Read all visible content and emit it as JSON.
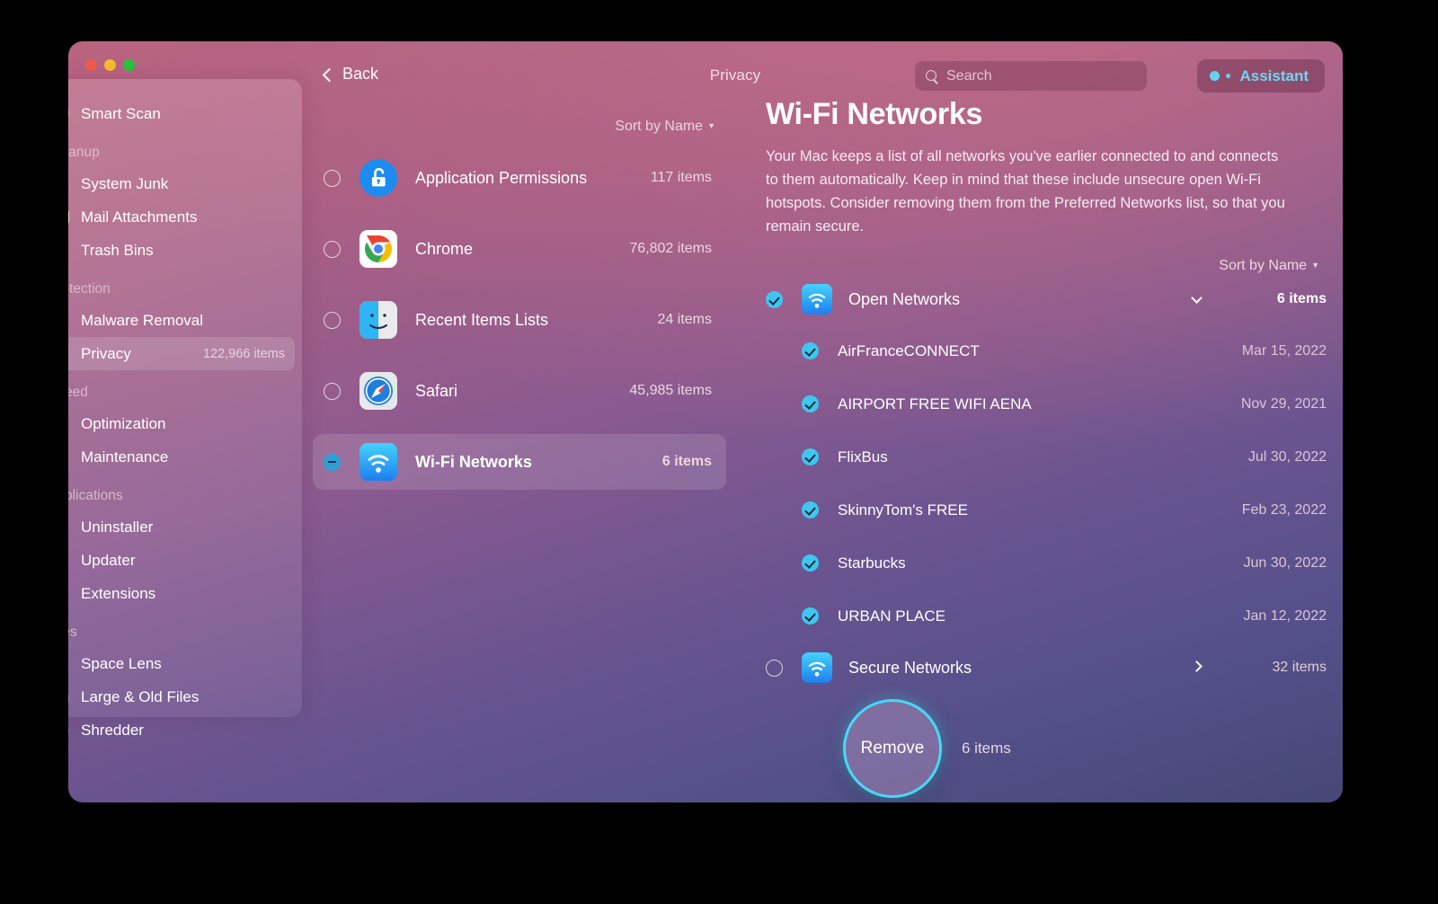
{
  "window": {
    "traffic_lights": [
      "close",
      "minimize",
      "zoom"
    ]
  },
  "toolbar": {
    "back_label": "Back",
    "title": "Privacy",
    "search_placeholder": "Search",
    "assistant_label": "Assistant"
  },
  "sidebar": {
    "items": [
      {
        "label": "Smart Scan",
        "icon": "monitor-scan-icon",
        "type": "item",
        "count": "",
        "selected": false
      },
      {
        "label": "Cleanup",
        "type": "group"
      },
      {
        "label": "System Junk",
        "icon": "junk-broom-icon",
        "type": "item",
        "count": "",
        "selected": false
      },
      {
        "label": "Mail Attachments",
        "icon": "envelope-icon",
        "type": "item",
        "count": "",
        "selected": false
      },
      {
        "label": "Trash Bins",
        "icon": "trash-bin-icon",
        "type": "item",
        "count": "",
        "selected": false
      },
      {
        "label": "Protection",
        "type": "group"
      },
      {
        "label": "Malware Removal",
        "icon": "biohazard-icon",
        "type": "item",
        "count": "",
        "selected": false
      },
      {
        "label": "Privacy",
        "icon": "red-hand-icon",
        "type": "item",
        "count": "122,966 items",
        "selected": true
      },
      {
        "label": "Speed",
        "type": "group"
      },
      {
        "label": "Optimization",
        "icon": "sliders-icon",
        "type": "item",
        "count": "",
        "selected": false
      },
      {
        "label": "Maintenance",
        "icon": "wrench-icon",
        "type": "item",
        "count": "",
        "selected": false
      },
      {
        "label": "Applications",
        "type": "group"
      },
      {
        "label": "Uninstaller",
        "icon": "app-molecule-icon",
        "type": "item",
        "count": "",
        "selected": false
      },
      {
        "label": "Updater",
        "icon": "update-arrow-icon",
        "type": "item",
        "count": "",
        "selected": false
      },
      {
        "label": "Extensions",
        "icon": "puzzle-piece-icon",
        "type": "item",
        "count": "",
        "selected": false
      },
      {
        "label": "Files",
        "type": "group"
      },
      {
        "label": "Space Lens",
        "icon": "planet-lens-icon",
        "type": "item",
        "count": "",
        "selected": false
      },
      {
        "label": "Large & Old Files",
        "icon": "folder-icon",
        "type": "item",
        "count": "",
        "selected": false
      },
      {
        "label": "Shredder",
        "icon": "shredder-icon",
        "type": "item",
        "count": "",
        "selected": false
      }
    ]
  },
  "middle": {
    "sort_label": "Sort by Name",
    "rows": [
      {
        "label": "Application Permissions",
        "count": "117 items",
        "icon": "unlock-blue-icon",
        "state": "unchecked",
        "selected": false
      },
      {
        "label": "Chrome",
        "count": "76,802 items",
        "icon": "chrome-icon",
        "state": "unchecked",
        "selected": false
      },
      {
        "label": "Recent Items Lists",
        "count": "24 items",
        "icon": "finder-icon",
        "state": "unchecked",
        "selected": false
      },
      {
        "label": "Safari",
        "count": "45,985 items",
        "icon": "safari-icon",
        "state": "unchecked",
        "selected": false
      },
      {
        "label": "Wi-Fi Networks",
        "count": "6 items",
        "icon": "wifi-icon",
        "state": "indeterminate",
        "selected": true
      }
    ]
  },
  "detail": {
    "title": "Wi-Fi Networks",
    "description": "Your Mac keeps a list of all networks you've earlier connected to and connects to them automatically. Keep in mind that these include unsecure open Wi-Fi hotspots. Consider removing them from the Preferred Networks list, so that you remain secure.",
    "sort_label": "Sort by Name",
    "groups": [
      {
        "label": "Open Networks",
        "count": "6 items",
        "icon": "wifi-icon",
        "state": "checked",
        "expanded": true,
        "networks": [
          {
            "name": "AirFranceCONNECT",
            "date": "Mar 15, 2022",
            "state": "checked"
          },
          {
            "name": "AIRPORT FREE WIFI AENA",
            "date": "Nov 29, 2021",
            "state": "checked"
          },
          {
            "name": "FlixBus",
            "date": "Jul 30, 2022",
            "state": "checked"
          },
          {
            "name": "SkinnyTom's FREE",
            "date": "Feb 23, 2022",
            "state": "checked"
          },
          {
            "name": "Starbucks",
            "date": "Jun 30, 2022",
            "state": "checked"
          },
          {
            "name": "URBAN PLACE",
            "date": "Jan 12, 2022",
            "state": "checked"
          }
        ]
      },
      {
        "label": "Secure Networks",
        "count": "32 items",
        "icon": "wifi-icon",
        "state": "unchecked",
        "expanded": false,
        "networks": []
      }
    ]
  },
  "footer": {
    "remove_label": "Remove",
    "selected_count": "6 items"
  },
  "colors": {
    "accent_cyan": "#3fc6ef",
    "highlight_ring": "#46d9f5",
    "assistant_text": "#6fd6f4",
    "bg_top": "#b9647f",
    "bg_bottom": "#474776",
    "privacy_icon_red": "#e8453c"
  }
}
